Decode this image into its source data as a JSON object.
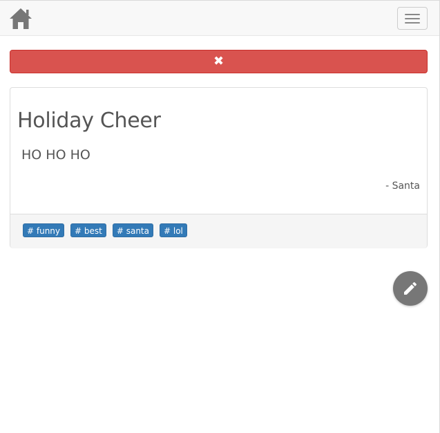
{
  "navbar": {
    "home_icon": "home-icon",
    "menu_icon": "hamburger-menu-icon"
  },
  "close_bar": {
    "icon": "close-icon",
    "glyph": "✖",
    "color": "#d9534f"
  },
  "card": {
    "title": "Holiday Cheer",
    "text": "HO HO HO",
    "author": "- Santa",
    "tags": [
      "# funny",
      "# best",
      "# santa",
      "# lol"
    ],
    "tag_color": "#337ab7"
  },
  "fab": {
    "icon": "pencil-icon",
    "color": "#777777"
  }
}
